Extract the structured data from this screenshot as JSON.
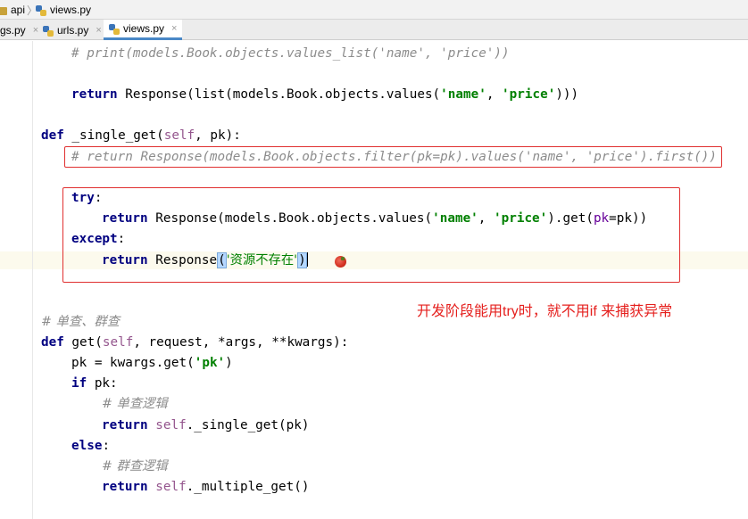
{
  "breadcrumb": {
    "folder": "api",
    "file": "views.py"
  },
  "tabs": [
    {
      "label": "gs.py",
      "close": "×"
    },
    {
      "label": "urls.py",
      "close": "×"
    },
    {
      "label": "views.py",
      "close": "×",
      "active": true
    }
  ],
  "code": {
    "l1": "# print(models.Book.objects.values_list('name', 'price'))",
    "l2_kw": "return",
    "l2_a": " Response(list(models.Book.objects.values(",
    "l2_s1": "'name'",
    "l2_b": ", ",
    "l2_s2": "'price'",
    "l2_c": ")))",
    "l3_kw": "def",
    "l3_a": " _single_get(",
    "l3_self": "self",
    "l3_b": ", pk):",
    "l4": "# return Response(models.Book.objects.filter(pk=pk).values('name', 'price').first())",
    "l5_kw": "try",
    "l5_a": ":",
    "l6_kw": "return",
    "l6_a": " Response(models.Book.objects.values(",
    "l6_s1": "'name'",
    "l6_b": ", ",
    "l6_s2": "'price'",
    "l6_c": ").get(",
    "l6_p": "pk",
    "l6_d": "=pk))",
    "l7_kw": "except",
    "l7_a": ":",
    "l8_kw": "return",
    "l8_a": " Response",
    "l8_open": "(",
    "l8_s": "'资源不存在'",
    "l8_close": ")",
    "l9": "# 单查、群查",
    "l10_kw": "def",
    "l10_a": " get(",
    "l10_self": "self",
    "l10_b": ", request, *args, **kwargs):",
    "l11_a": "pk = kwargs.get(",
    "l11_s": "'pk'",
    "l11_b": ")",
    "l12_kw": "if",
    "l12_a": " pk:",
    "l13": "# 单查逻辑",
    "l14_kw": "return",
    "l14_a": " ",
    "l14_self": "self",
    "l14_b": "._single_get(pk)",
    "l15_kw": "else",
    "l15_a": ":",
    "l16": "# 群查逻辑",
    "l17_kw": "return",
    "l17_a": " ",
    "l17_self": "self",
    "l17_b": "._multiple_get()"
  },
  "annotation": "开发阶段能用try时，就不用if 来捕获异常",
  "colors": {
    "keyword": "#000080",
    "string": "#008000",
    "comment": "#8c8c8c",
    "self": "#94558d",
    "annotation": "#e5201e",
    "highlight_box": "#e03030"
  }
}
